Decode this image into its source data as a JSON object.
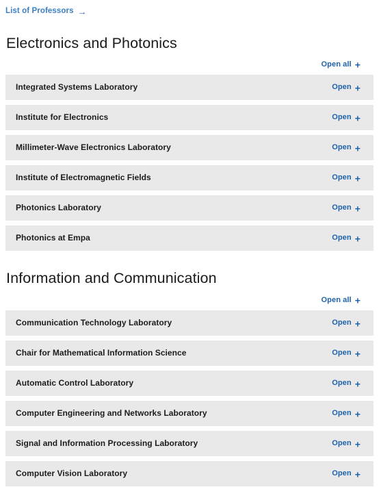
{
  "top_link": {
    "label": "List of Professors",
    "arrow_glyph": "→",
    "color": "#3b7fc4"
  },
  "labels": {
    "open_all": "Open all",
    "open": "Open",
    "plus_glyph": "+"
  },
  "colors": {
    "link_blue": "#1f62a8",
    "toplink_blue": "#3b7fc4",
    "row_background": "#e9e9e9",
    "heading_text": "#1b1b1b",
    "row_text": "#1c1c1c",
    "page_background": "#ffffff"
  },
  "sections": [
    {
      "title": "Electronics and Photonics",
      "open_all_label": "Open all",
      "rows": [
        {
          "label": "Integrated Systems Laboratory",
          "toggle": "Open"
        },
        {
          "label": "Institute for Electronics",
          "toggle": "Open"
        },
        {
          "label": "Millimeter-Wave Electronics Laboratory",
          "toggle": "Open"
        },
        {
          "label": "Institute of Electromagnetic Fields",
          "toggle": "Open"
        },
        {
          "label": "Photonics Laboratory",
          "toggle": "Open"
        },
        {
          "label": "Photonics at Empa",
          "toggle": "Open"
        }
      ]
    },
    {
      "title": "Information and Communication",
      "open_all_label": "Open all",
      "rows": [
        {
          "label": "Communication Technology Laboratory",
          "toggle": "Open"
        },
        {
          "label": "Chair for Mathematical Information Science",
          "toggle": "Open"
        },
        {
          "label": "Automatic Control Laboratory",
          "toggle": "Open"
        },
        {
          "label": "Computer Engineering and Networks Laboratory",
          "toggle": "Open"
        },
        {
          "label": "Signal and Information Processing Laboratory",
          "toggle": "Open"
        },
        {
          "label": "Computer Vision Laboratory",
          "toggle": "Open"
        }
      ]
    }
  ]
}
